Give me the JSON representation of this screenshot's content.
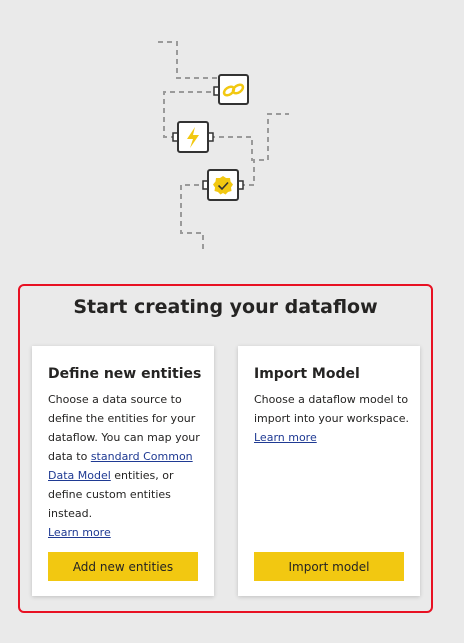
{
  "illustration": {
    "icons": [
      "link-icon",
      "lightning-icon",
      "verified-badge-icon"
    ],
    "accent_color": "#f2c811"
  },
  "panel": {
    "title": "Start creating your dataflow",
    "highlight_color": "#e81123"
  },
  "cards": {
    "define": {
      "title": "Define new entities",
      "desc_before_link": "Choose a data source to define the entities for your dataflow. You can map your data to ",
      "inline_link": "standard Common Data Model",
      "desc_after_link": " entities, or define custom entities instead.",
      "learn_more": "Learn more",
      "button": "Add new entities"
    },
    "import": {
      "title": "Import Model",
      "desc": "Choose a dataflow model to import into your workspace.",
      "learn_more": "Learn more",
      "button": "Import model"
    }
  }
}
